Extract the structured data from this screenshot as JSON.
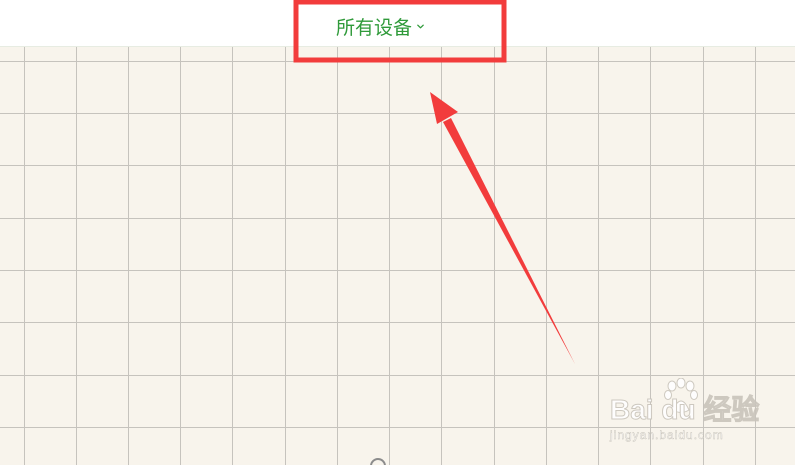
{
  "header": {
    "device_selector_label": "所有设备",
    "device_selector_icon": "chevron-down-icon"
  },
  "annotation": {
    "highlight_color": "#f23c3c",
    "arrow_color": "#f23c3c"
  },
  "watermark": {
    "logo_text": "Bai du 经验",
    "url_text": "jingyan.baidu.com"
  },
  "colors": {
    "accent_green": "#2f9a3a",
    "grid_background": "#f8f4ec",
    "grid_line": "#c6c3bd"
  }
}
